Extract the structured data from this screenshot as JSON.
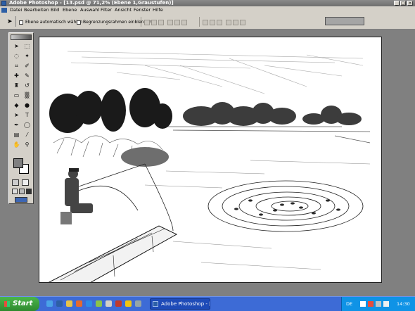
{
  "window": {
    "title": "Adobe Photoshop - [13.psd @ 71,2% (Ebene 1,Graustufen)]",
    "minimize_label": "_",
    "maximize_label": "□",
    "close_label": "×"
  },
  "menubar": {
    "items": [
      "Datei",
      "Bearbeiten",
      "Bild",
      "Ebene",
      "Auswahl",
      "Filter",
      "Ansicht",
      "Fenster",
      "Hilfe"
    ]
  },
  "options_bar": {
    "auto_select_label": "Ebene automatisch wählen",
    "show_bounds_label": "Begrenzungsrahmen einblenden",
    "auto_select_checked": false,
    "show_bounds_checked": false
  },
  "toolbox": {
    "tools": [
      "move-tool-icon",
      "marquee-icon",
      "lasso-icon",
      "magic-wand-icon",
      "crop-icon",
      "slice-icon",
      "healing-brush-icon",
      "brush-icon",
      "clone-stamp-icon",
      "history-brush-icon",
      "eraser-icon",
      "gradient-icon",
      "blur-icon",
      "dodge-icon",
      "path-select-icon",
      "type-icon",
      "pen-icon",
      "shape-icon",
      "notes-icon",
      "eyedropper-icon",
      "hand-icon",
      "zoom-icon"
    ],
    "colors": {
      "foreground": "#7f7f7f",
      "background": "#ffffff"
    }
  },
  "taskbar": {
    "start_label": "Start",
    "task_label": "Adobe Photoshop - [...",
    "lang": "DE",
    "clock": "14:30"
  },
  "colors": {
    "chrome": "#d4d0c8",
    "workspace": "#808080",
    "taskbar": "#3d6bd6",
    "start": "#3a9e3a",
    "tray": "#0f93e6"
  }
}
